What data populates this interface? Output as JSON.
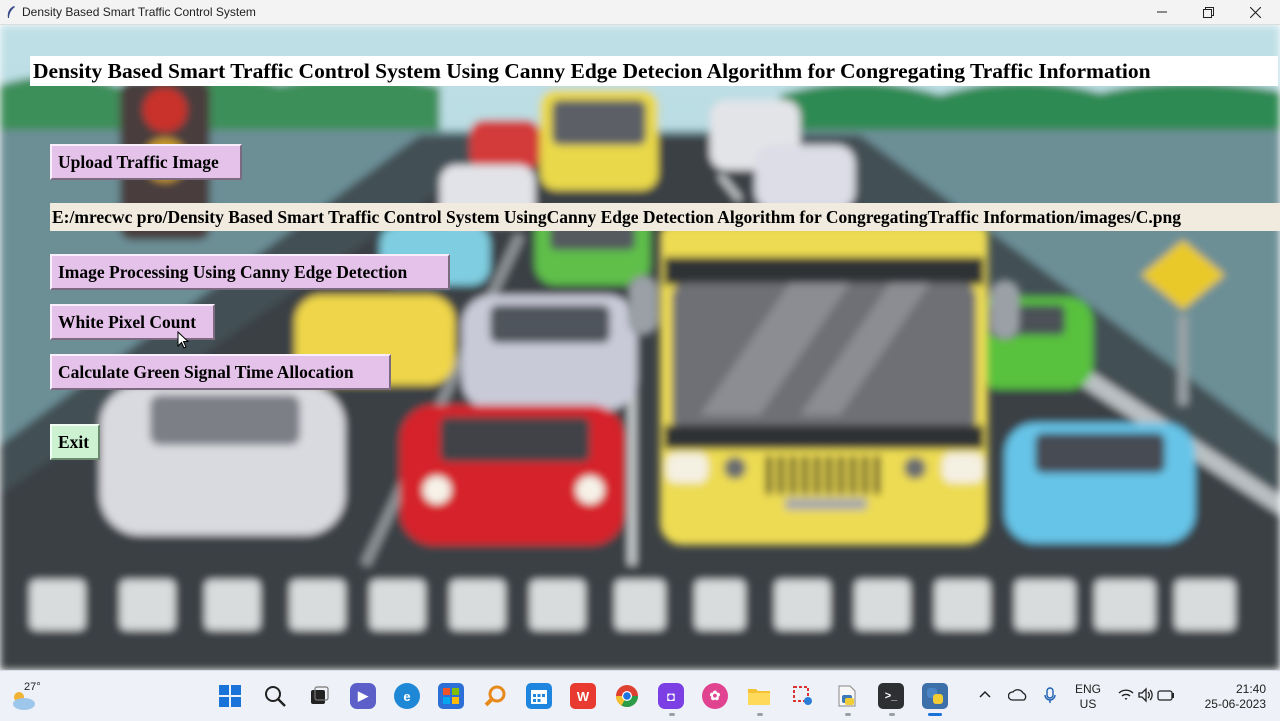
{
  "window": {
    "title": "Density Based Smart Traffic Control System"
  },
  "app": {
    "heading": "Density Based Smart Traffic Control System Using Canny Edge Detecion Algorithm for Congregating Traffic Information",
    "upload_button": "Upload Traffic Image",
    "path_label": "E:/mrecwc pro/Density Based Smart Traffic Control System UsingCanny Edge Detection Algorithm for CongregatingTraffic Information/images/C.png",
    "canny_button": "Image Processing Using Canny Edge Detection",
    "white_pixel_button": "White Pixel Count",
    "green_signal_button": "Calculate Green Signal Time Allocation",
    "exit_button": "Exit"
  },
  "colors": {
    "button_lavender": "#e4c2e9",
    "button_mint": "#ccf2d2",
    "path_label_bg": "#f1ebdf"
  },
  "taskbar": {
    "weather_temp": "27°",
    "apps": [
      "start-icon",
      "search-icon",
      "task-view-icon",
      "teams-chat-icon",
      "edge-icon",
      "store-icon",
      "search-magnifier-app-icon",
      "calendar-icon",
      "wps-icon",
      "chrome-icon",
      "app-purple-icon",
      "app-pink-icon",
      "file-explorer-icon",
      "snipping-icon",
      "python-file-icon",
      "terminal-icon",
      "python-tk-icon"
    ],
    "language": "ENG",
    "region": "US",
    "time": "21:40",
    "date": "25-06-2023"
  }
}
